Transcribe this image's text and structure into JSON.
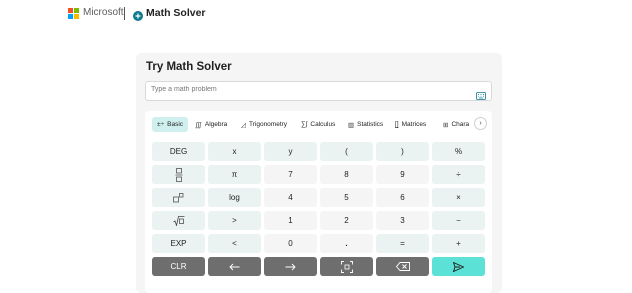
{
  "header": {
    "brand": "Microsoft",
    "app_name": "Math Solver",
    "logo_colors": [
      "#f25022",
      "#7fba00",
      "#00a4ef",
      "#ffb900"
    ]
  },
  "solver": {
    "title": "Try Math Solver",
    "input_placeholder": "Type a math problem",
    "input_value": ""
  },
  "tabs": [
    {
      "label": "Basic",
      "icon": "±÷",
      "active": true
    },
    {
      "label": "Algebra",
      "icon": "∭",
      "active": false
    },
    {
      "label": "Trigonometry",
      "icon": "◿",
      "active": false
    },
    {
      "label": "Calculus",
      "icon": "∑∫",
      "active": false
    },
    {
      "label": "Statistics",
      "icon": "▥",
      "active": false
    },
    {
      "label": "Matrices",
      "icon": "⦋⦌",
      "active": false
    },
    {
      "label": "Chara",
      "icon": "⊞",
      "active": false
    }
  ],
  "keys": {
    "row1": [
      "DEG",
      "x",
      "y",
      "(",
      ")",
      "%"
    ],
    "row2": [
      "fraction",
      "π",
      "7",
      "8",
      "9",
      "÷"
    ],
    "row3": [
      "exponent",
      "log",
      "4",
      "5",
      "6",
      "×"
    ],
    "row4": [
      "root",
      ">",
      "1",
      "2",
      "3",
      "−"
    ],
    "row5": [
      "EXP",
      "<",
      "0",
      ".",
      "=",
      "+"
    ],
    "row6": [
      "CLR",
      "left-arrow",
      "right-arrow",
      "matrix",
      "backspace",
      "send"
    ]
  },
  "colors": {
    "accent": "#5ce1d6",
    "key_dark": "#6e6e6e",
    "tab_active": "#d0f0ef"
  }
}
